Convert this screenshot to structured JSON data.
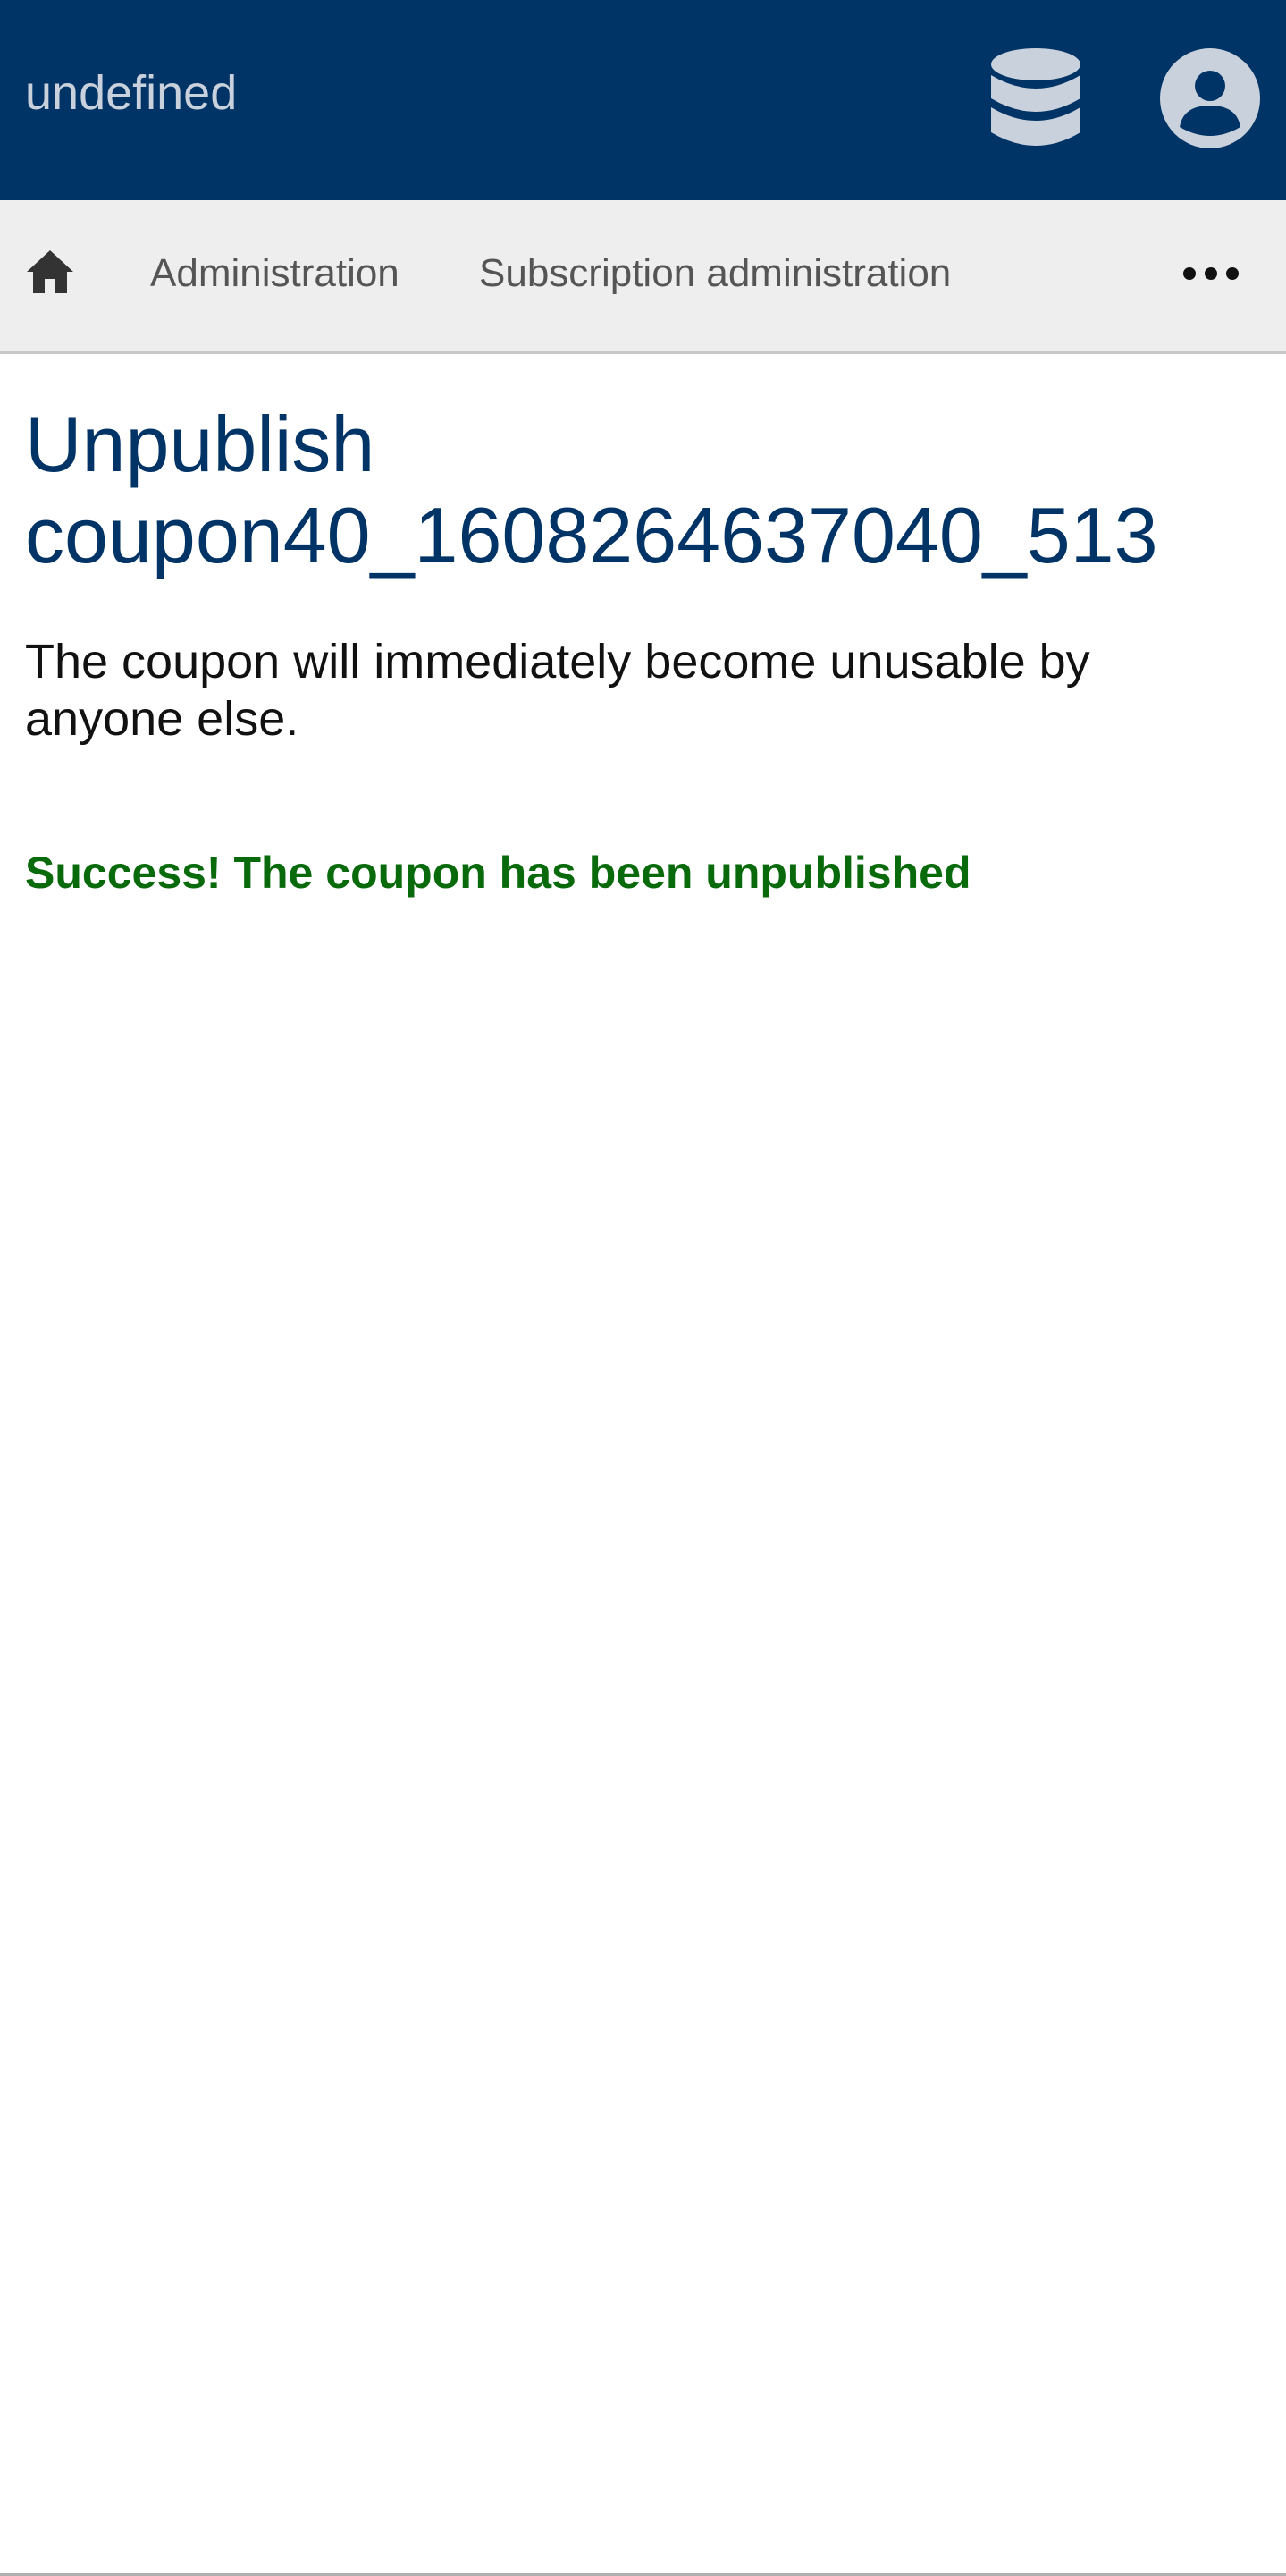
{
  "header": {
    "app_title": "undefined",
    "background_color": "#003366",
    "database_icon": "database-icon",
    "user_icon": "user-account-icon"
  },
  "nav": {
    "home_icon": "home-icon",
    "items": [
      {
        "label": "Administration"
      },
      {
        "label": "Subscription administration"
      }
    ],
    "more_icon": "more-options-icon"
  },
  "main": {
    "title": "Unpublish coupon40_1608264637040_513",
    "description": "The coupon will immediately become unusable by anyone else.",
    "success_message": "Success! The coupon has been unpublished",
    "success_color": "#086a0b"
  }
}
